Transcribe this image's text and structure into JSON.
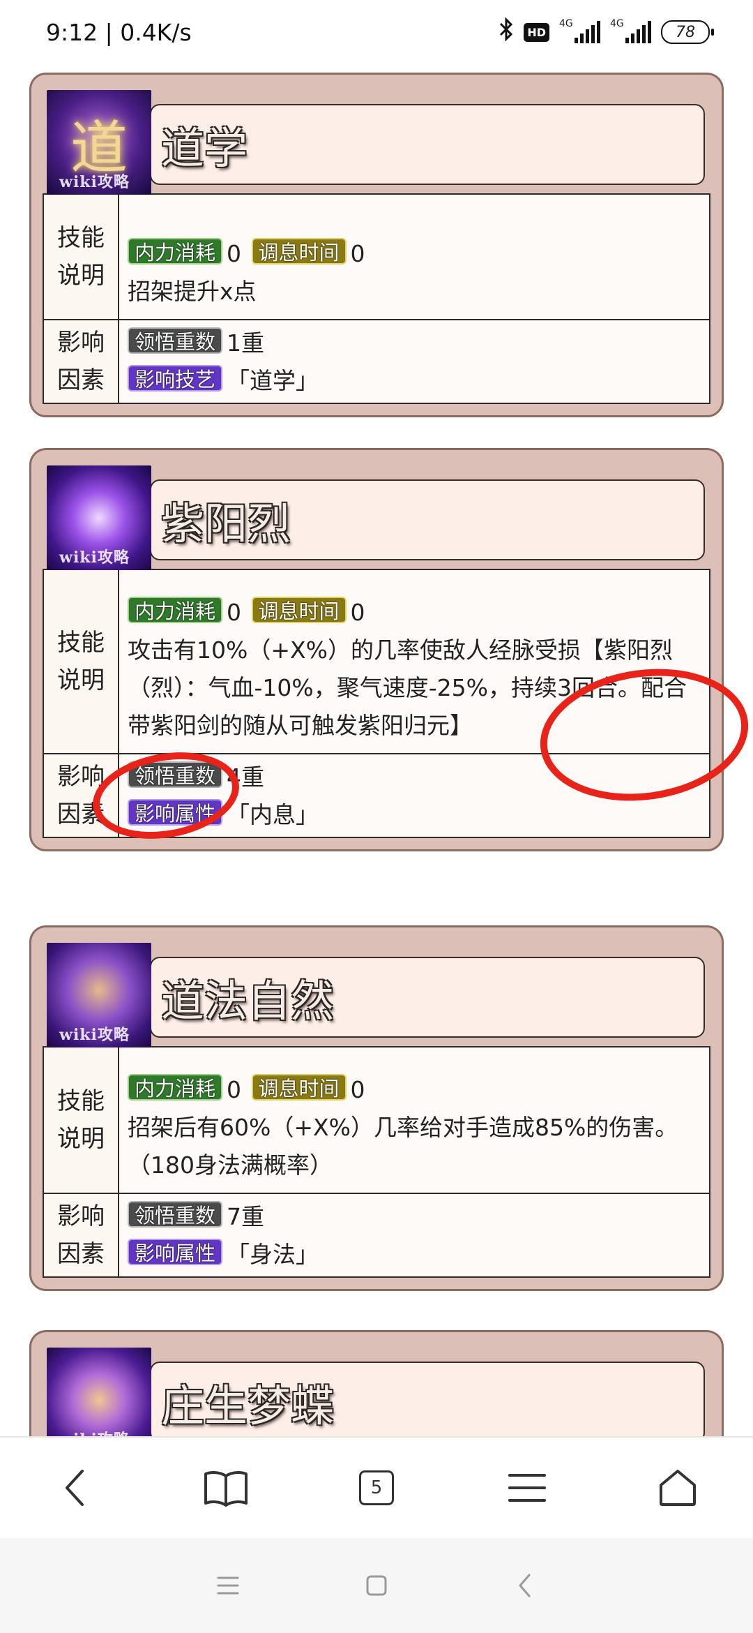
{
  "status_bar": {
    "time": "9:12 | 0.4K/s",
    "hd": "HD",
    "sig1": "4G",
    "sig2": "4G",
    "battery": "78"
  },
  "labels": {
    "desc_line1": "技能",
    "desc_line2": "说明",
    "factor_line1": "影响",
    "factor_line2": "因素"
  },
  "skills": [
    {
      "name": "道学",
      "icon_glyph": "道",
      "watermark": "wiki攻略",
      "tag_cost": "内力消耗",
      "cost": "0",
      "tag_cd": "调息时间",
      "cd": "0",
      "description": "招架提升x点",
      "tag_rank": "领悟重数",
      "rank": "1重",
      "tag_factor": "影响技艺",
      "factor": "「道学」"
    },
    {
      "name": "紫阳烈",
      "icon_glyph": "",
      "watermark": "wiki攻略",
      "tag_cost": "内力消耗",
      "cost": "0",
      "tag_cd": "调息时间",
      "cd": "0",
      "description": "攻击有10%（+X%）的几率使敌人经脉受损【紫阳烈（烈）：气血-10%，聚气速度-25%，持续3回合。配合带紫阳剑的随从可触发紫阳归元】",
      "tag_rank": "领悟重数",
      "rank": "4重",
      "tag_factor": "影响属性",
      "factor": "「内息」"
    },
    {
      "name": "道法自然",
      "icon_glyph": "",
      "watermark": "wiki攻略",
      "tag_cost": "内力消耗",
      "cost": "0",
      "tag_cd": "调息时间",
      "cd": "0",
      "description": "招架后有60%（+X%）几率给对手造成85%的伤害。（180身法满概率）",
      "tag_rank": "领悟重数",
      "rank": "7重",
      "tag_factor": "影响属性",
      "factor": "「身法」"
    },
    {
      "name": "庄生梦蝶",
      "watermark": "wiki攻略"
    }
  ],
  "browser_bar": {
    "tab_count": "5"
  },
  "colors": {
    "card_bg": "#dcbfb6",
    "card_border": "#8c6b60",
    "annotation_red": "#e8231a",
    "tag_green": "#2f7a2a",
    "tag_olive": "#8a7a14",
    "tag_dark": "#4b4b4b",
    "tag_purple": "#6236c4"
  },
  "icons": {
    "back": "chevron-left-icon",
    "bookmarks": "book-icon",
    "tabs": "tabs-icon",
    "menu": "hamburger-menu-icon",
    "home": "home-icon"
  }
}
